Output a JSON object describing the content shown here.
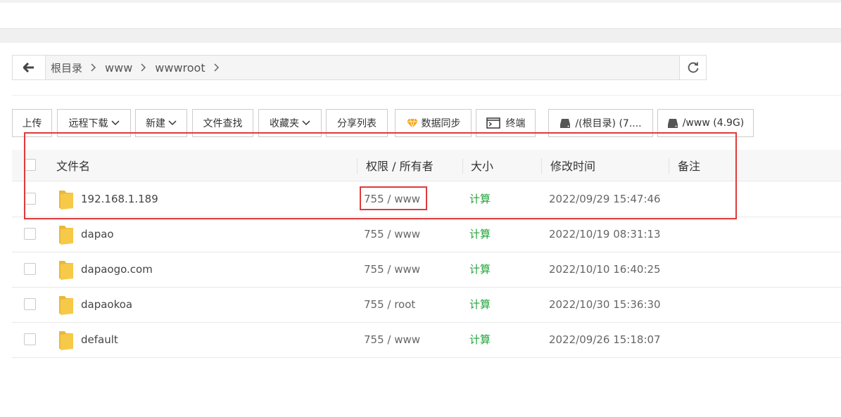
{
  "path": {
    "items": [
      "根目录",
      "www",
      "wwwroot"
    ]
  },
  "toolbar": {
    "upload": "上传",
    "remote_download": "远程下载",
    "new": "新建",
    "file_search": "文件查找",
    "favorites": "收藏夹",
    "share_list": "分享列表",
    "data_sync": "数据同步",
    "terminal": "终端",
    "disk_root": "/(根目录) (7....",
    "disk_www": "/www (4.9G)"
  },
  "table": {
    "headers": {
      "name": "文件名",
      "perm": "权限 / 所有者",
      "size": "大小",
      "mtime": "修改时间",
      "note": "备注"
    },
    "rows": [
      {
        "name": "192.168.1.189",
        "perm": "755 / www",
        "size": "计算",
        "mtime": "2022/09/29 15:47:46"
      },
      {
        "name": "dapao",
        "perm": "755 / www",
        "size": "计算",
        "mtime": "2022/10/19 08:31:13"
      },
      {
        "name": "dapaogo.com",
        "perm": "755 / www",
        "size": "计算",
        "mtime": "2022/10/10 16:40:25"
      },
      {
        "name": "dapaokoa",
        "perm": "755 / root",
        "size": "计算",
        "mtime": "2022/10/30 15:36:30"
      },
      {
        "name": "default",
        "perm": "755 / www",
        "size": "计算",
        "mtime": "2022/09/26 15:18:07"
      }
    ]
  },
  "colors": {
    "accent_green": "#20a53a",
    "highlight_red": "#e03a3a",
    "folder_yellow": "#f7c948"
  },
  "icons": [
    "arrow-left-icon",
    "chevron-right-icon",
    "refresh-icon",
    "chevron-down-icon",
    "diamond-icon",
    "terminal-icon",
    "disk-icon",
    "folder-icon"
  ]
}
